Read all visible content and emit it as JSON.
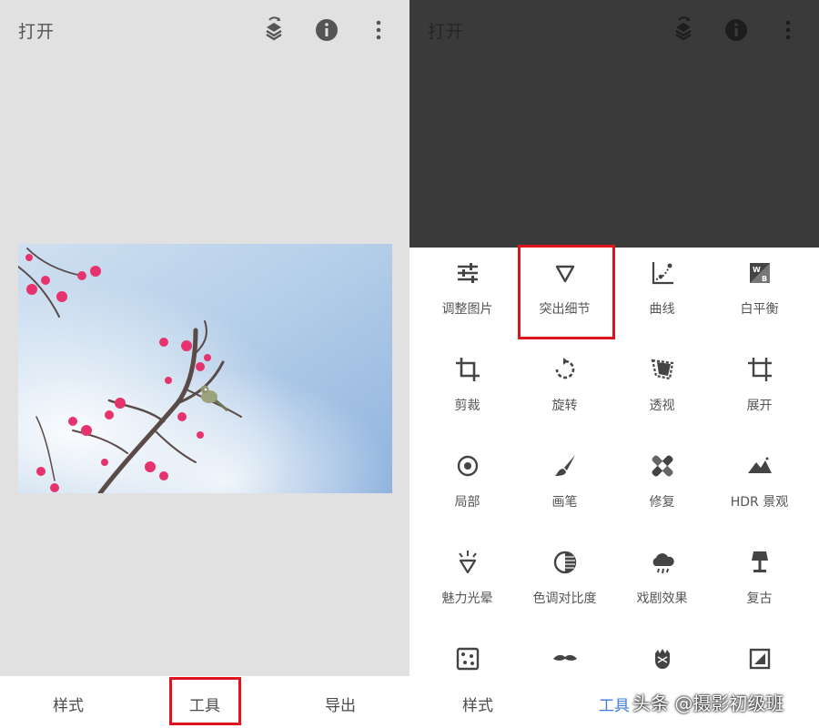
{
  "left": {
    "title": "打开",
    "photo_alt": "",
    "bottom_tabs": {
      "styles": "样式",
      "tools": "工具",
      "export": "导出"
    }
  },
  "right": {
    "title": "打开",
    "tools": [
      {
        "label": "调整图片",
        "icon": "tune-sliders-icon"
      },
      {
        "label": "突出细节",
        "icon": "details-triangle-icon"
      },
      {
        "label": "曲线",
        "icon": "curves-icon"
      },
      {
        "label": "白平衡",
        "icon": "white-balance-icon"
      },
      {
        "label": "剪裁",
        "icon": "crop-icon"
      },
      {
        "label": "旋转",
        "icon": "rotate-icon"
      },
      {
        "label": "透视",
        "icon": "perspective-icon"
      },
      {
        "label": "展开",
        "icon": "expand-icon"
      },
      {
        "label": "局部",
        "icon": "selective-icon"
      },
      {
        "label": "画笔",
        "icon": "brush-icon"
      },
      {
        "label": "修复",
        "icon": "healing-icon"
      },
      {
        "label": "HDR 景观",
        "icon": "hdr-mountains-icon"
      },
      {
        "label": "魅力光晕",
        "icon": "glamour-glow-icon"
      },
      {
        "label": "色调对比度",
        "icon": "tonal-contrast-icon"
      },
      {
        "label": "戏剧效果",
        "icon": "drama-cloud-icon"
      },
      {
        "label": "复古",
        "icon": "vintage-lamp-icon"
      },
      {
        "label": "",
        "icon": "grainy-film-icon"
      },
      {
        "label": "",
        "icon": "retrolux-mustache-icon"
      },
      {
        "label": "",
        "icon": "grunge-icon"
      },
      {
        "label": "",
        "icon": "black-white-icon"
      }
    ],
    "bottom_tabs": {
      "styles": "样式",
      "tools": "工具"
    }
  },
  "watermark": "头条 @摄影初级班",
  "colors": {
    "highlight": "#e0141d",
    "active_tab": "#3f7ae0",
    "sky": "#a9c6e6",
    "blossom": "#e6336e"
  }
}
